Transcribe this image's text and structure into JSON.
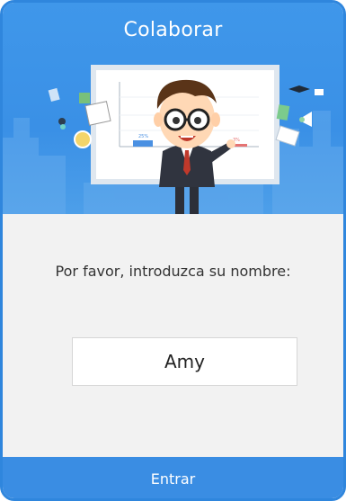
{
  "header": {
    "title": "Colaborar"
  },
  "illustration": {
    "chart_labels": [
      "25%",
      "3%"
    ]
  },
  "form": {
    "prompt": "Por favor, introduzca su nombre:",
    "name_value": "Amy"
  },
  "footer": {
    "enter_label": "Entrar"
  },
  "colors": {
    "accent": "#3a8de3",
    "background": "#f2f2f2",
    "border": "#2f86dd"
  }
}
